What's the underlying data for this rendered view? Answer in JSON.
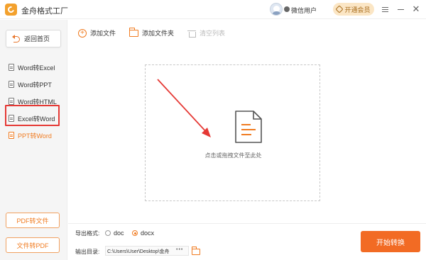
{
  "app": {
    "title": "金舟格式工厂"
  },
  "user": {
    "name": "微信用户"
  },
  "header": {
    "vip_label": "开通会员"
  },
  "sidebar": {
    "back_label": "返回首页",
    "items": [
      {
        "label": "Word转Excel",
        "active": false
      },
      {
        "label": "Word转PPT",
        "active": false
      },
      {
        "label": "Word转HTML",
        "active": false
      },
      {
        "label": "Excel转Word",
        "active": false
      },
      {
        "label": "PPT转Word",
        "active": true
      }
    ],
    "pdf_to_file_label": "PDF转文件",
    "file_to_pdf_label": "文件转PDF"
  },
  "toolbar": {
    "add_file_label": "添加文件",
    "add_folder_label": "添加文件夹",
    "clear_list_label": "清空列表"
  },
  "dropzone": {
    "hint": "点击或拖拽文件至此处"
  },
  "bottom": {
    "format_label": "导出格式:",
    "formats": [
      {
        "label": "doc",
        "selected": false
      },
      {
        "label": "docx",
        "selected": true
      }
    ],
    "dir_label": "输出目录:",
    "dir_value": "C:\\Users\\User\\Desktop\\金舟",
    "dir_more": "•••",
    "start_label": "开始转换"
  },
  "colors": {
    "accent": "#f07b20",
    "start_button": "#f26b24",
    "annotation_red": "#e53935"
  }
}
